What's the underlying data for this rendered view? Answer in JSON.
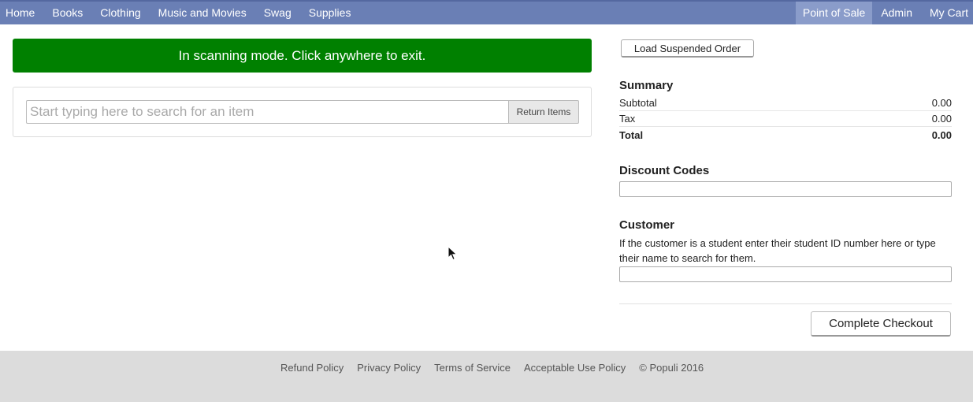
{
  "nav": {
    "left": [
      "Home",
      "Books",
      "Clothing",
      "Music and Movies",
      "Swag",
      "Supplies"
    ],
    "right": [
      "Point of Sale",
      "Admin",
      "My Cart"
    ],
    "active": "Point of Sale"
  },
  "scan_banner": "In scanning mode. Click anywhere to exit.",
  "search": {
    "placeholder": "Start typing here to search for an item",
    "value": "",
    "return_label": "Return Items"
  },
  "load_suspended_label": "Load Suspended Order",
  "summary": {
    "title": "Summary",
    "rows": [
      {
        "label": "Subtotal",
        "value": "0.00"
      },
      {
        "label": "Tax",
        "value": "0.00"
      },
      {
        "label": "Total",
        "value": "0.00"
      }
    ]
  },
  "discount": {
    "title": "Discount Codes",
    "value": ""
  },
  "customer": {
    "title": "Customer",
    "help": "If the customer is a student enter their student ID number here or type their name to search for them.",
    "value": ""
  },
  "checkout_label": "Complete Checkout",
  "footer": {
    "links": [
      "Refund Policy",
      "Privacy Policy",
      "Terms of Service",
      "Acceptable Use Policy"
    ],
    "copyright": "© Populi 2016"
  },
  "colors": {
    "nav_bg": "#6a7fb5",
    "nav_active": "#8a9cca",
    "banner_bg": "#008000",
    "footer_bg": "#dcdcdc"
  }
}
